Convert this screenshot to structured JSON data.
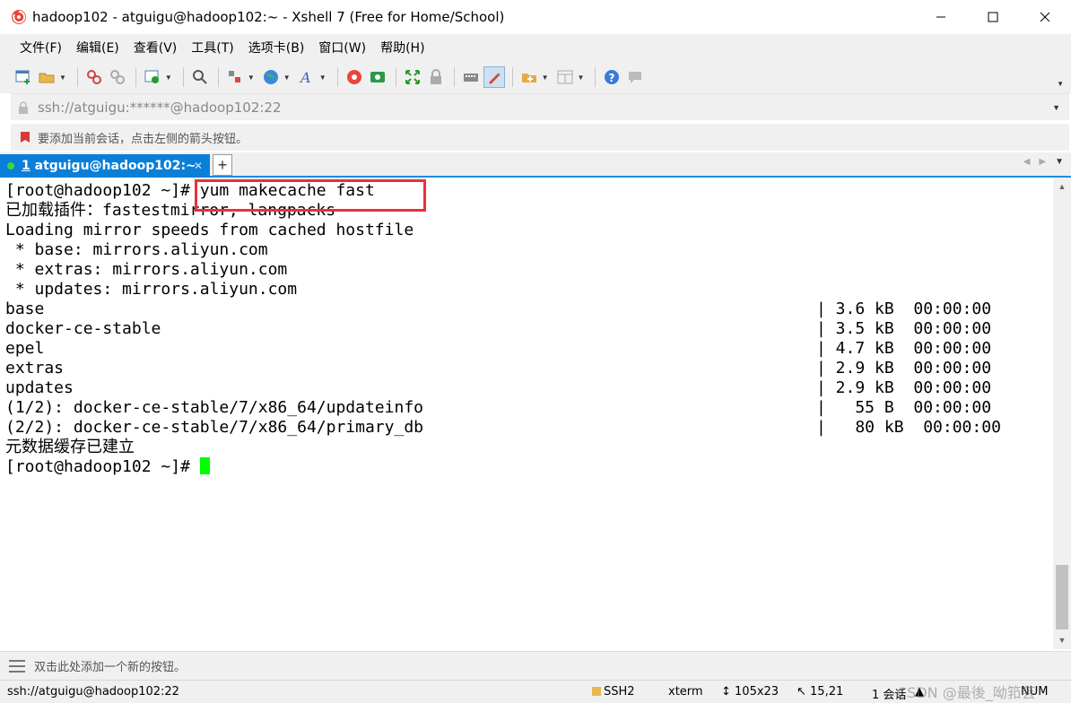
{
  "window": {
    "title": "hadoop102 - atguigu@hadoop102:~ - Xshell 7 (Free for Home/School)",
    "minimize_label": "—",
    "maximize_label": "☐",
    "close_label": "✕"
  },
  "menu": [
    "文件(F)",
    "编辑(E)",
    "查看(V)",
    "工具(T)",
    "选项卡(B)",
    "窗口(W)",
    "帮助(H)"
  ],
  "address": {
    "value": "ssh://atguigu:******@hadoop102:22"
  },
  "hint": {
    "text": "要添加当前会话，点击左侧的箭头按钮。"
  },
  "tab": {
    "number": "1",
    "label": " atguigu@hadoop102:~",
    "close": "✕",
    "add": "+"
  },
  "terminal": {
    "lines": [
      {
        "left": "[root@hadoop102 ~]# yum makecache fast",
        "right": ""
      },
      {
        "left": "已加载插件：fastestmirror, langpacks",
        "right": ""
      },
      {
        "left": "Loading mirror speeds from cached hostfile",
        "right": ""
      },
      {
        "left": " * base: mirrors.aliyun.com",
        "right": ""
      },
      {
        "left": " * extras: mirrors.aliyun.com",
        "right": ""
      },
      {
        "left": " * updates: mirrors.aliyun.com",
        "right": ""
      },
      {
        "left": "base",
        "right": "| 3.6 kB  00:00:00"
      },
      {
        "left": "docker-ce-stable",
        "right": "| 3.5 kB  00:00:00"
      },
      {
        "left": "epel",
        "right": "| 4.7 kB  00:00:00"
      },
      {
        "left": "extras",
        "right": "| 2.9 kB  00:00:00"
      },
      {
        "left": "updates",
        "right": "| 2.9 kB  00:00:00"
      },
      {
        "left": "(1/2): docker-ce-stable/7/x86_64/updateinfo",
        "right": "|   55 B  00:00:00"
      },
      {
        "left": "(2/2): docker-ce-stable/7/x86_64/primary_db",
        "right": "|   80 kB  00:00:00"
      },
      {
        "left": "元数据缓存已建立",
        "right": ""
      }
    ],
    "prompt": "[root@hadoop102 ~]# "
  },
  "quickbar": {
    "text": "双击此处添加一个新的按钮。"
  },
  "status": {
    "connection": "ssh://atguigu@hadoop102:22",
    "protocol": "SSH2",
    "term_type": "xterm",
    "size": "105x23",
    "cursor_pos": "15,21",
    "sessions": "1 会话",
    "num": "NUM",
    "watermark": "CSDN @最後_呦筘芸"
  },
  "colors": {
    "tab_active": "#0a7fd8",
    "cursor": "#00ff00",
    "highlight": "#e8313a"
  }
}
